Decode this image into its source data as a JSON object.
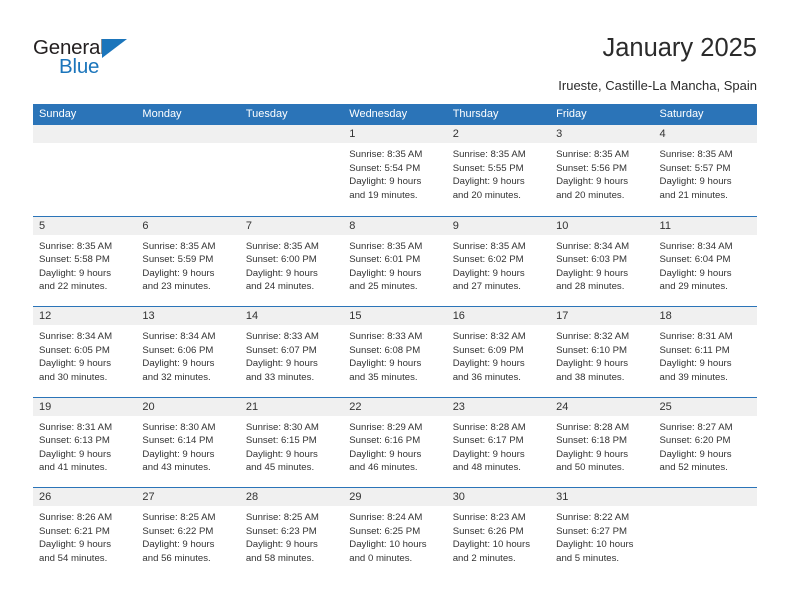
{
  "brand": {
    "name_top": "General",
    "name_bottom": "Blue",
    "accent_color": "#1b75bb"
  },
  "header": {
    "title": "January 2025",
    "subtitle": "Irueste, Castille-La Mancha, Spain"
  },
  "theme": {
    "header_bar_color": "#2b74b8",
    "day_bar_color": "#f0f0f0",
    "text_color": "#333333"
  },
  "weekdays": [
    "Sunday",
    "Monday",
    "Tuesday",
    "Wednesday",
    "Thursday",
    "Friday",
    "Saturday"
  ],
  "weeks": [
    [
      {
        "day": "",
        "lines": []
      },
      {
        "day": "",
        "lines": []
      },
      {
        "day": "",
        "lines": []
      },
      {
        "day": "1",
        "lines": [
          "Sunrise: 8:35 AM",
          "Sunset: 5:54 PM",
          "Daylight: 9 hours",
          "and 19 minutes."
        ]
      },
      {
        "day": "2",
        "lines": [
          "Sunrise: 8:35 AM",
          "Sunset: 5:55 PM",
          "Daylight: 9 hours",
          "and 20 minutes."
        ]
      },
      {
        "day": "3",
        "lines": [
          "Sunrise: 8:35 AM",
          "Sunset: 5:56 PM",
          "Daylight: 9 hours",
          "and 20 minutes."
        ]
      },
      {
        "day": "4",
        "lines": [
          "Sunrise: 8:35 AM",
          "Sunset: 5:57 PM",
          "Daylight: 9 hours",
          "and 21 minutes."
        ]
      }
    ],
    [
      {
        "day": "5",
        "lines": [
          "Sunrise: 8:35 AM",
          "Sunset: 5:58 PM",
          "Daylight: 9 hours",
          "and 22 minutes."
        ]
      },
      {
        "day": "6",
        "lines": [
          "Sunrise: 8:35 AM",
          "Sunset: 5:59 PM",
          "Daylight: 9 hours",
          "and 23 minutes."
        ]
      },
      {
        "day": "7",
        "lines": [
          "Sunrise: 8:35 AM",
          "Sunset: 6:00 PM",
          "Daylight: 9 hours",
          "and 24 minutes."
        ]
      },
      {
        "day": "8",
        "lines": [
          "Sunrise: 8:35 AM",
          "Sunset: 6:01 PM",
          "Daylight: 9 hours",
          "and 25 minutes."
        ]
      },
      {
        "day": "9",
        "lines": [
          "Sunrise: 8:35 AM",
          "Sunset: 6:02 PM",
          "Daylight: 9 hours",
          "and 27 minutes."
        ]
      },
      {
        "day": "10",
        "lines": [
          "Sunrise: 8:34 AM",
          "Sunset: 6:03 PM",
          "Daylight: 9 hours",
          "and 28 minutes."
        ]
      },
      {
        "day": "11",
        "lines": [
          "Sunrise: 8:34 AM",
          "Sunset: 6:04 PM",
          "Daylight: 9 hours",
          "and 29 minutes."
        ]
      }
    ],
    [
      {
        "day": "12",
        "lines": [
          "Sunrise: 8:34 AM",
          "Sunset: 6:05 PM",
          "Daylight: 9 hours",
          "and 30 minutes."
        ]
      },
      {
        "day": "13",
        "lines": [
          "Sunrise: 8:34 AM",
          "Sunset: 6:06 PM",
          "Daylight: 9 hours",
          "and 32 minutes."
        ]
      },
      {
        "day": "14",
        "lines": [
          "Sunrise: 8:33 AM",
          "Sunset: 6:07 PM",
          "Daylight: 9 hours",
          "and 33 minutes."
        ]
      },
      {
        "day": "15",
        "lines": [
          "Sunrise: 8:33 AM",
          "Sunset: 6:08 PM",
          "Daylight: 9 hours",
          "and 35 minutes."
        ]
      },
      {
        "day": "16",
        "lines": [
          "Sunrise: 8:32 AM",
          "Sunset: 6:09 PM",
          "Daylight: 9 hours",
          "and 36 minutes."
        ]
      },
      {
        "day": "17",
        "lines": [
          "Sunrise: 8:32 AM",
          "Sunset: 6:10 PM",
          "Daylight: 9 hours",
          "and 38 minutes."
        ]
      },
      {
        "day": "18",
        "lines": [
          "Sunrise: 8:31 AM",
          "Sunset: 6:11 PM",
          "Daylight: 9 hours",
          "and 39 minutes."
        ]
      }
    ],
    [
      {
        "day": "19",
        "lines": [
          "Sunrise: 8:31 AM",
          "Sunset: 6:13 PM",
          "Daylight: 9 hours",
          "and 41 minutes."
        ]
      },
      {
        "day": "20",
        "lines": [
          "Sunrise: 8:30 AM",
          "Sunset: 6:14 PM",
          "Daylight: 9 hours",
          "and 43 minutes."
        ]
      },
      {
        "day": "21",
        "lines": [
          "Sunrise: 8:30 AM",
          "Sunset: 6:15 PM",
          "Daylight: 9 hours",
          "and 45 minutes."
        ]
      },
      {
        "day": "22",
        "lines": [
          "Sunrise: 8:29 AM",
          "Sunset: 6:16 PM",
          "Daylight: 9 hours",
          "and 46 minutes."
        ]
      },
      {
        "day": "23",
        "lines": [
          "Sunrise: 8:28 AM",
          "Sunset: 6:17 PM",
          "Daylight: 9 hours",
          "and 48 minutes."
        ]
      },
      {
        "day": "24",
        "lines": [
          "Sunrise: 8:28 AM",
          "Sunset: 6:18 PM",
          "Daylight: 9 hours",
          "and 50 minutes."
        ]
      },
      {
        "day": "25",
        "lines": [
          "Sunrise: 8:27 AM",
          "Sunset: 6:20 PM",
          "Daylight: 9 hours",
          "and 52 minutes."
        ]
      }
    ],
    [
      {
        "day": "26",
        "lines": [
          "Sunrise: 8:26 AM",
          "Sunset: 6:21 PM",
          "Daylight: 9 hours",
          "and 54 minutes."
        ]
      },
      {
        "day": "27",
        "lines": [
          "Sunrise: 8:25 AM",
          "Sunset: 6:22 PM",
          "Daylight: 9 hours",
          "and 56 minutes."
        ]
      },
      {
        "day": "28",
        "lines": [
          "Sunrise: 8:25 AM",
          "Sunset: 6:23 PM",
          "Daylight: 9 hours",
          "and 58 minutes."
        ]
      },
      {
        "day": "29",
        "lines": [
          "Sunrise: 8:24 AM",
          "Sunset: 6:25 PM",
          "Daylight: 10 hours",
          "and 0 minutes."
        ]
      },
      {
        "day": "30",
        "lines": [
          "Sunrise: 8:23 AM",
          "Sunset: 6:26 PM",
          "Daylight: 10 hours",
          "and 2 minutes."
        ]
      },
      {
        "day": "31",
        "lines": [
          "Sunrise: 8:22 AM",
          "Sunset: 6:27 PM",
          "Daylight: 10 hours",
          "and 5 minutes."
        ]
      },
      {
        "day": "",
        "lines": []
      }
    ]
  ]
}
